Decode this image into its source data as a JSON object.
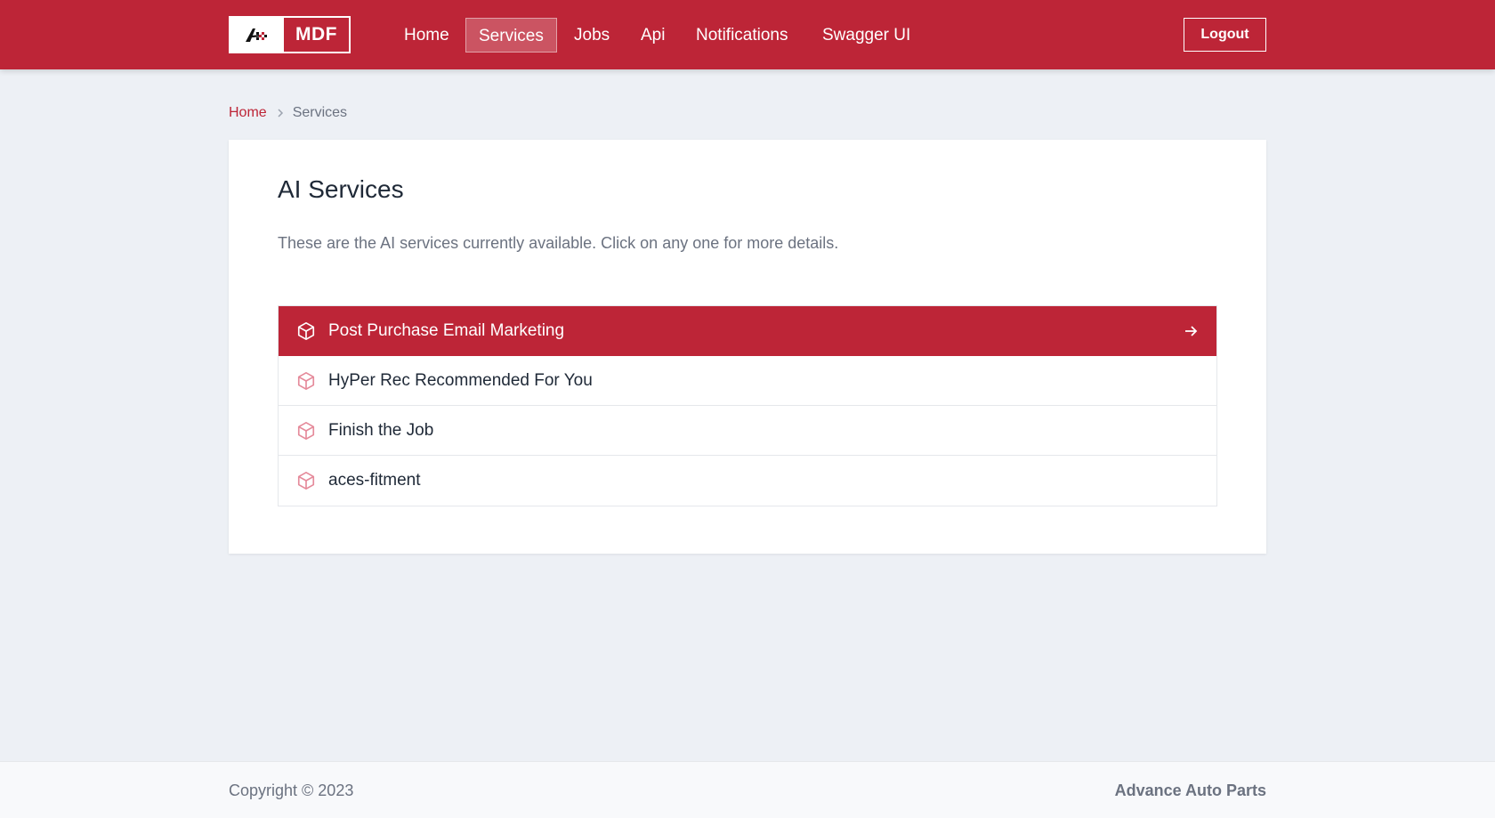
{
  "brand": {
    "name": "MDF",
    "accent": "#bd2537"
  },
  "nav": {
    "items": [
      {
        "label": "Home"
      },
      {
        "label": "Services"
      },
      {
        "label": "Jobs"
      },
      {
        "label": "Api"
      },
      {
        "label": "Notifications"
      },
      {
        "label": "Swagger UI"
      }
    ],
    "active": "Services",
    "logout_label": "Logout"
  },
  "breadcrumb": {
    "home": "Home",
    "current": "Services"
  },
  "main": {
    "title": "AI Services",
    "description": "These are the AI services currently available. Click on any one for more details.",
    "services": [
      {
        "label": "Post Purchase Email Marketing",
        "icon": "cube-icon",
        "highlighted": true
      },
      {
        "label": "HyPer Rec Recommended For You",
        "icon": "cube-icon",
        "highlighted": false
      },
      {
        "label": "Finish the Job",
        "icon": "cube-icon",
        "highlighted": false
      },
      {
        "label": "aces-fitment",
        "icon": "cube-icon",
        "highlighted": false
      }
    ]
  },
  "footer": {
    "copyright": "Copyright © 2023",
    "company": "Advance Auto Parts"
  }
}
